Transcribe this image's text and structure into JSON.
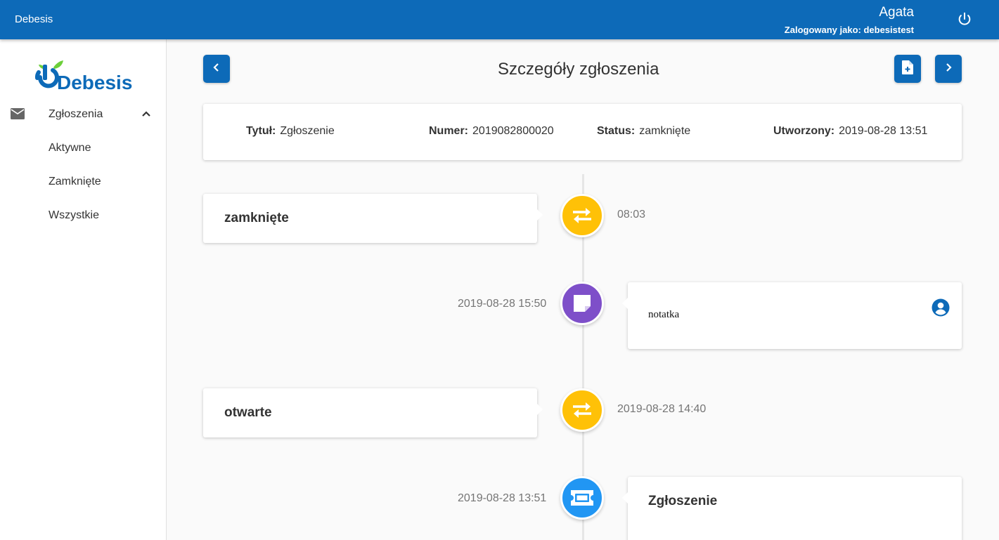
{
  "appbar": {
    "brand": "Debesis",
    "user_name": "Agata",
    "login_info": "Zalogowany jako: debesistest",
    "logout_icon": "power-icon"
  },
  "sidebar": {
    "logo_text": "Debesis",
    "group": {
      "label": "Zgłoszenia",
      "icon": "mail-icon",
      "expanded": true
    },
    "items": [
      {
        "label": "Aktywne"
      },
      {
        "label": "Zamknięte"
      },
      {
        "label": "Wszystkie"
      }
    ]
  },
  "header": {
    "title": "Szczegóły zgłoszenia",
    "prev_icon": "chevron-left-icon",
    "add_file_icon": "file-add-icon",
    "next_icon": "chevron-right-icon"
  },
  "info": {
    "title_label": "Tytuł:",
    "title_value": "Zgłoszenie",
    "number_label": "Numer:",
    "number_value": "2019082800020",
    "status_label": "Status:",
    "status_value": "zamknięte",
    "created_label": "Utworzony:",
    "created_value": "2019-08-28 13:51"
  },
  "timeline": [
    {
      "type": "status",
      "icon": "swap-arrows-icon",
      "color": "#ffc107",
      "text": "zamknięte",
      "time": "08:03"
    },
    {
      "type": "note",
      "icon": "note-icon",
      "color": "#7e4fc9",
      "text": "notatka",
      "time": "2019-08-28 15:50",
      "author_icon": "account-circle-icon"
    },
    {
      "type": "status",
      "icon": "swap-arrows-icon",
      "color": "#ffc107",
      "text": "otwarte",
      "time": "2019-08-28 14:40"
    },
    {
      "type": "ticket",
      "icon": "ticket-icon",
      "color": "#2196f3",
      "text": "Zgłoszenie",
      "time": "2019-08-28 13:51"
    }
  ],
  "colors": {
    "primary": "#0d6ab8",
    "status": "#ffc107",
    "note": "#7e4fc9",
    "ticket": "#2196f3"
  }
}
